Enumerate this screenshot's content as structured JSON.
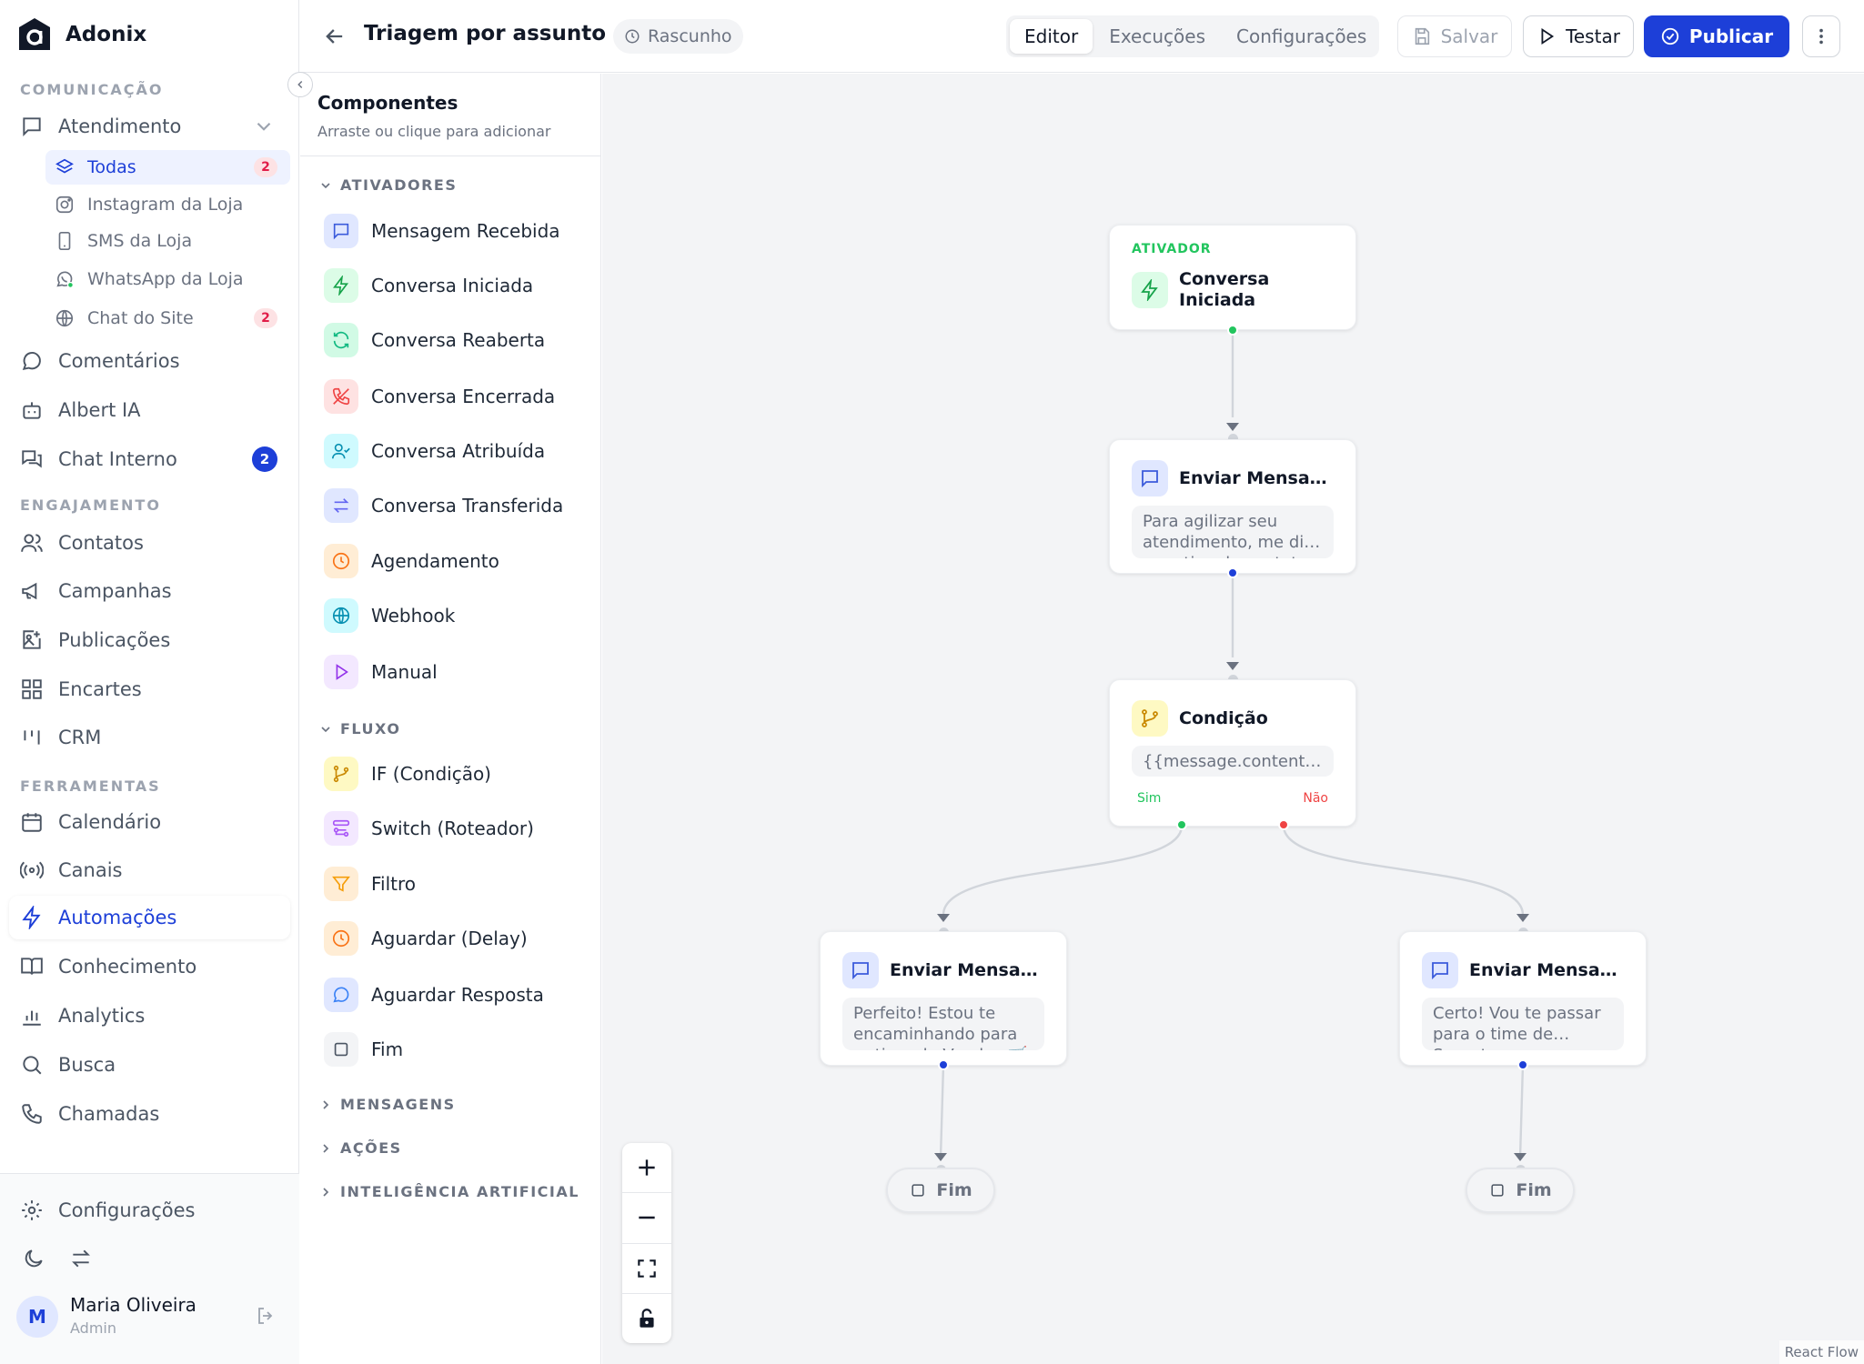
{
  "brand": {
    "name": "Adonix"
  },
  "sidebar": {
    "sections": {
      "comunicacao": "COMUNICAÇÃO",
      "engajamento": "ENGAJAMENTO",
      "ferramentas": "FERRAMENTAS"
    },
    "atendimento": {
      "label": "Atendimento"
    },
    "subitems": [
      {
        "label": "Todas",
        "badge": "2"
      },
      {
        "label": "Instagram da Loja"
      },
      {
        "label": "SMS da Loja"
      },
      {
        "label": "WhatsApp da Loja"
      },
      {
        "label": "Chat do Site",
        "badge": "2"
      }
    ],
    "comunicacao_items": [
      {
        "label": "Comentários"
      },
      {
        "label": "Albert IA"
      },
      {
        "label": "Chat Interno",
        "badge": "2"
      }
    ],
    "engajamento_items": [
      {
        "label": "Contatos"
      },
      {
        "label": "Campanhas"
      },
      {
        "label": "Publicações"
      },
      {
        "label": "Encartes"
      },
      {
        "label": "CRM"
      }
    ],
    "ferramentas_items": [
      {
        "label": "Calendário"
      },
      {
        "label": "Canais"
      },
      {
        "label": "Automações"
      },
      {
        "label": "Conhecimento"
      },
      {
        "label": "Analytics"
      },
      {
        "label": "Busca"
      },
      {
        "label": "Chamadas"
      }
    ],
    "settings": {
      "label": "Configurações"
    },
    "user": {
      "initial": "M",
      "name": "Maria Oliveira",
      "role": "Admin"
    }
  },
  "topbar": {
    "title": "Triagem por assunto",
    "status": "Rascunho",
    "tabs": [
      "Editor",
      "Execuções",
      "Configurações"
    ],
    "active_tab": "Editor",
    "save": "Salvar",
    "test": "Testar",
    "publish": "Publicar"
  },
  "panel": {
    "title": "Componentes",
    "subtitle": "Arraste ou clique para adicionar",
    "groups": {
      "ativadores": "ATIVADORES",
      "fluxo": "FLUXO",
      "mensagens": "MENSAGENS",
      "acoes": "AÇÕES",
      "ia": "INTELIGÊNCIA ARTIFICIAL"
    },
    "ativadores": [
      {
        "label": "Mensagem Recebida",
        "icon": "message-square-icon"
      },
      {
        "label": "Conversa Iniciada",
        "icon": "zap-icon"
      },
      {
        "label": "Conversa Reaberta",
        "icon": "refresh-icon"
      },
      {
        "label": "Conversa Encerrada",
        "icon": "phone-off-icon"
      },
      {
        "label": "Conversa Atribuída",
        "icon": "user-check-icon"
      },
      {
        "label": "Conversa Transferida",
        "icon": "arrows-swap-icon"
      },
      {
        "label": "Agendamento",
        "icon": "clock-icon"
      },
      {
        "label": "Webhook",
        "icon": "globe-icon"
      },
      {
        "label": "Manual",
        "icon": "play-icon"
      }
    ],
    "fluxo": [
      {
        "label": "IF (Condição)",
        "icon": "git-branch-icon"
      },
      {
        "label": "Switch (Roteador)",
        "icon": "route-icon"
      },
      {
        "label": "Filtro",
        "icon": "filter-icon"
      },
      {
        "label": "Aguardar (Delay)",
        "icon": "clock-icon"
      },
      {
        "label": "Aguardar Resposta",
        "icon": "message-circle-icon"
      },
      {
        "label": "Fim",
        "icon": "square-icon"
      }
    ]
  },
  "flow": {
    "trigger": {
      "tag": "ATIVADOR",
      "title": "Conversa Iniciada"
    },
    "msg1": {
      "title": "Enviar Mensag…",
      "preview": "Para agilizar seu atendimento, me di… o motivo do contato"
    },
    "condition": {
      "title": "Condição",
      "expr": "{{message.content…",
      "yes": "Sim",
      "no": "Não"
    },
    "msg_yes": {
      "title": "Enviar Mensag…",
      "preview": "Perfeito! Estou te encaminhando para … time de Vendas 🛒"
    },
    "msg_no": {
      "title": "Enviar Mensag…",
      "preview": "Certo! Vou te passar para o time de… Suporte agora"
    },
    "end": "Fim",
    "attribution": "React Flow"
  },
  "colors": {
    "accent": "#1d3fd8",
    "success": "#22c55e",
    "danger": "#ef4444"
  }
}
